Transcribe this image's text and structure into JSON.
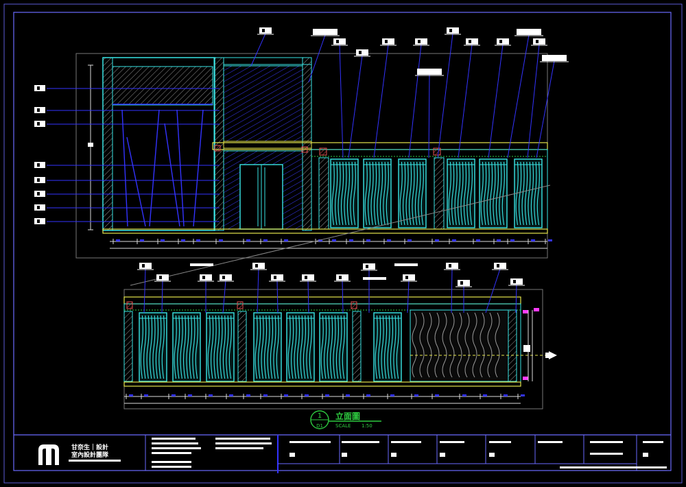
{
  "drawing": {
    "title": "立面圖",
    "detail_number": "1",
    "sheet_ref": "D1",
    "scale_label": "SCALE",
    "scale_value": "1:50"
  },
  "title_block": {
    "company": "甘奈生｜設計",
    "subtitle": "室內設計團隊"
  },
  "colors": {
    "background": "#000000",
    "frame": "#6a6aff",
    "wall": "#39e6e6",
    "structure": "#3333ff",
    "trim": "#e6e64c",
    "label": "#ffffff",
    "accent": "#2ecc40",
    "hatch": "#c8c8c8",
    "marker": "#ff3cff",
    "brick": "#e05050"
  }
}
